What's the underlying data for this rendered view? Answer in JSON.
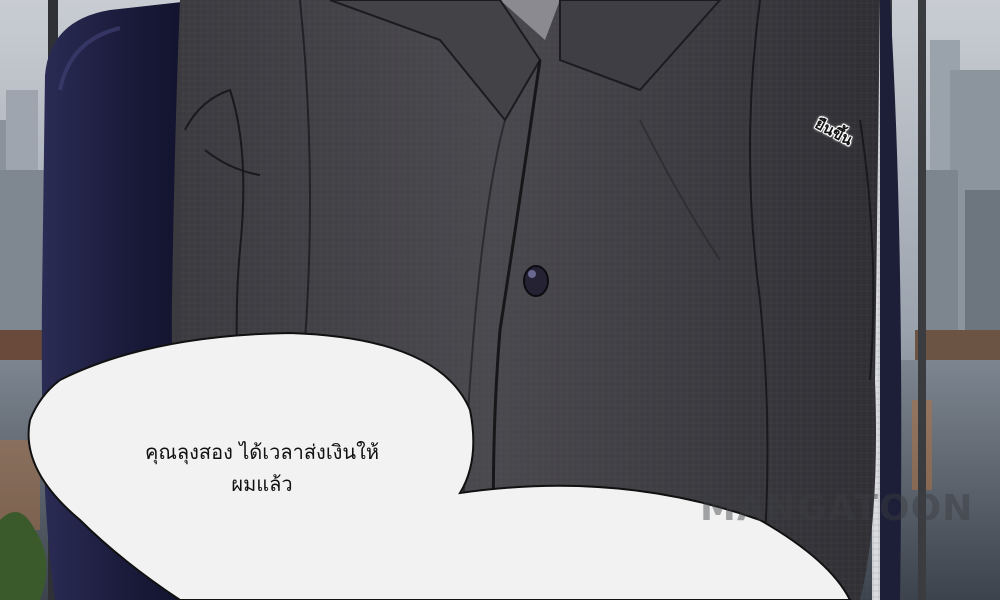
{
  "panel": {
    "sfx_text": "ยืนขึ้น",
    "speech_bubble": {
      "line1": "คุณลุงสอง ได้เวลาส่งเงินให้",
      "line2": "ผมแล้ว"
    },
    "watermark": "MANGATOON"
  }
}
